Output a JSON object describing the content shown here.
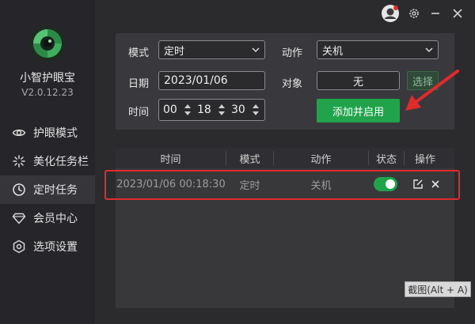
{
  "app": {
    "name": "小智护眼宝",
    "version": "V2.0.12.23"
  },
  "sidebar": {
    "items": [
      {
        "label": "护眼模式",
        "icon": "eye-icon",
        "active": false
      },
      {
        "label": "美化任务栏",
        "icon": "sparkle-icon",
        "active": false
      },
      {
        "label": "定时任务",
        "icon": "clock-icon",
        "active": true
      },
      {
        "label": "会员中心",
        "icon": "diamond-icon",
        "active": false
      },
      {
        "label": "选项设置",
        "icon": "settings-icon",
        "active": false
      }
    ]
  },
  "window_controls": {
    "icons": [
      "avatar-icon",
      "gear-icon",
      "minimize-icon",
      "close-icon"
    ]
  },
  "form": {
    "mode_label": "模式",
    "mode_value": "定时",
    "action_label": "动作",
    "action_value": "关机",
    "date_label": "日期",
    "date_value": "2023/01/06",
    "target_label": "对象",
    "target_value": "无",
    "choose_label": "选择",
    "time_label": "时间",
    "time_hour": "00",
    "time_minute": "18",
    "time_second": "30",
    "add_button": "添加并启用"
  },
  "table": {
    "columns": [
      "时间",
      "模式",
      "动作",
      "状态",
      "操作"
    ],
    "rows": [
      {
        "time": "2023/01/06 00:18:30",
        "mode": "定时",
        "action": "关机",
        "enabled": true
      }
    ]
  },
  "tooltip": "截图(Alt + A)",
  "colors": {
    "accent": "#20a34b",
    "highlight": "#e02b2b",
    "background": "#2b2b2e",
    "sidebar": "#26262a"
  }
}
